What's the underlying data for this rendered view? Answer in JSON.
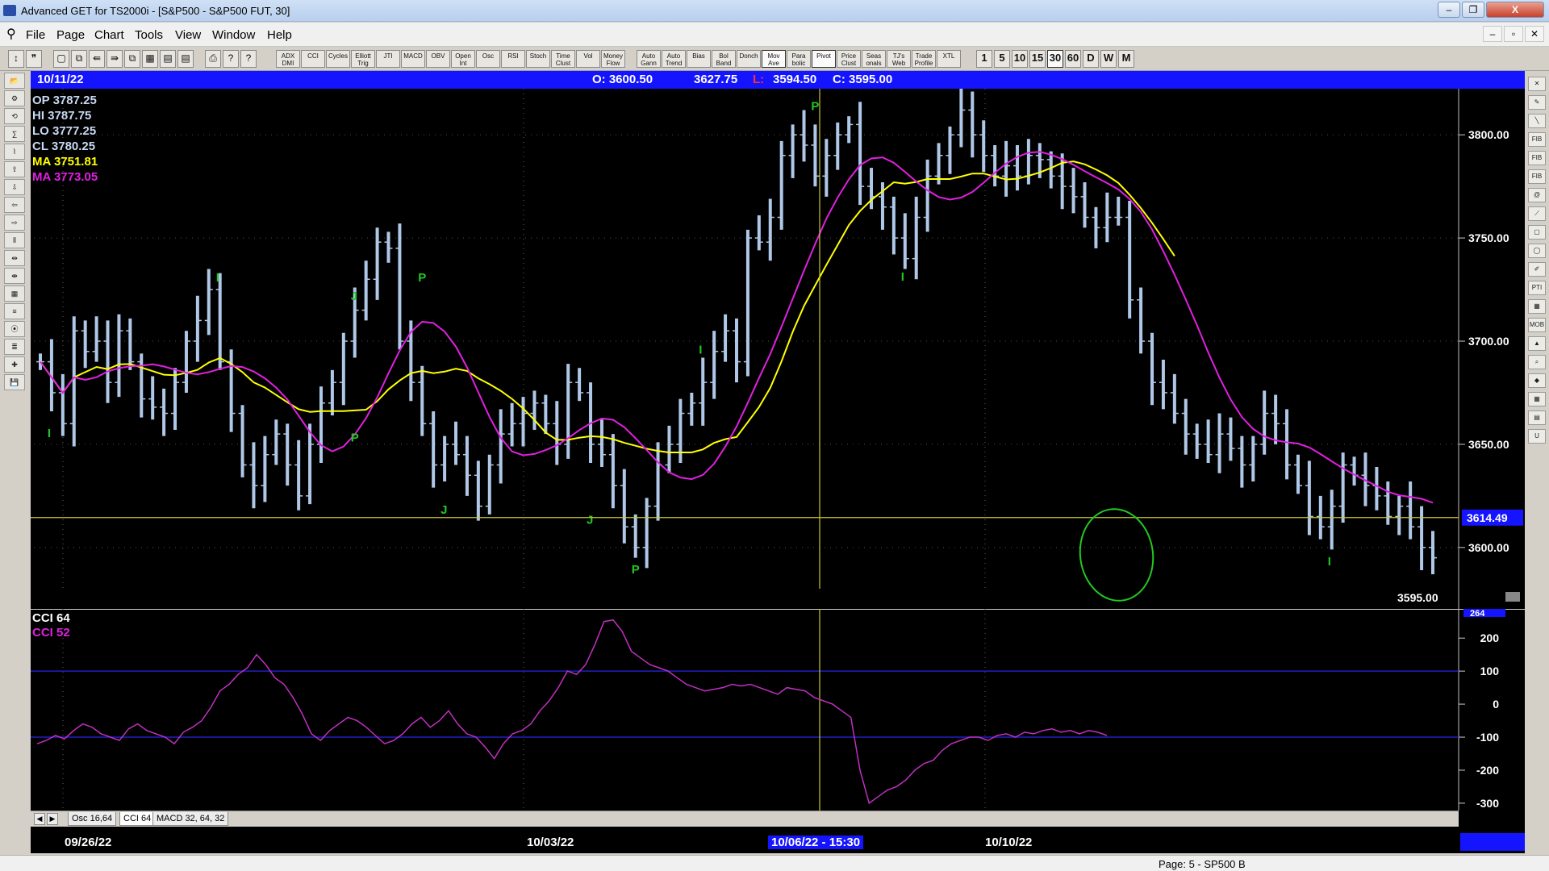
{
  "window": {
    "title": "Advanced GET for TS2000i - [S&P500 - S&P500 FUT, 30]",
    "minimize": "–",
    "restore": "❐",
    "close": "X"
  },
  "menu": {
    "items": [
      "File",
      "Page",
      "Chart",
      "Tools",
      "View",
      "Window",
      "Help"
    ],
    "mdi_buttons": [
      "–",
      "▫",
      "✕"
    ]
  },
  "toolbar": {
    "study_buttons": [
      "ADX DMI",
      "CCI",
      "Cycles",
      "Elliott Trig",
      "JTI",
      "MACD",
      "OBV",
      "Open Int",
      "Osc",
      "RSI",
      "Stoch",
      "Time Clust",
      "Vol",
      "Money Flow",
      "Auto Gann",
      "Auto Trend",
      "Bias",
      "Bol Band",
      "Donch",
      "Mov Ave",
      "Para bolic",
      "Pivot",
      "Price Clust",
      "Seas onals",
      "TJ's Web",
      "Trade Profile",
      "XTL"
    ],
    "interval_buttons": [
      "1",
      "5",
      "10",
      "15",
      "30",
      "60",
      "D",
      "W",
      "M"
    ],
    "active_interval": "30"
  },
  "left_tools": [
    "open",
    "studies",
    "reset",
    "study",
    "elliott",
    "up",
    "down",
    "left",
    "right",
    "bars",
    "spread",
    "compress",
    "grid",
    "lines",
    "gann",
    "fib",
    "cross",
    "save"
  ],
  "right_tools": [
    "close",
    "pencil",
    "line",
    "fib ret",
    "fib ext",
    "fib time",
    "spiral",
    "fan",
    "box",
    "ellipse",
    "brush",
    "PTI",
    "grid",
    "MOB",
    "up",
    "zoom",
    "paint",
    "grid2",
    "calc",
    "magnet"
  ],
  "info_bar": {
    "date": "10/11/22",
    "open": "O: 3600.50",
    "high": "3627.75",
    "low_label": "L:",
    "low_value": "3594.50",
    "close": "C: 3595.00"
  },
  "ohlc_panel": {
    "op": "OP  3787.25",
    "hi": "HI   3787.75",
    "lo": "LO  3777.25",
    "cl": "CL  3780.25",
    "ma1": "MA  3751.81",
    "ma2": "MA  3773.05"
  },
  "price_axis": {
    "ticks": [
      "3800.00",
      "3750.00",
      "3700.00",
      "3650.00",
      "3600.00"
    ],
    "cursor_price": "3614.49",
    "last_price": "3595.00"
  },
  "indicator": {
    "label1": "CCI 64",
    "label2": "CCI  52",
    "ticks": [
      "200",
      "100",
      "0",
      "-100",
      "-200",
      "-300"
    ],
    "top_value": "264"
  },
  "indicator_tabs": {
    "nav_left": "◀",
    "nav_right": "▶",
    "tabs": [
      "Osc 16,64",
      "CCI 64",
      "MACD 32, 64, 32"
    ],
    "active": "CCI 64"
  },
  "dates": {
    "d1": "09/26/22",
    "d2": "10/03/22",
    "d3": "10/06/22 - 15:30",
    "d4": "10/10/22"
  },
  "status": {
    "page": "Page: 5 - SP500 B"
  },
  "colors": {
    "background": "#000000",
    "bars": "#b0c8e8",
    "ma_yellow": "#ffff00",
    "ma_magenta": "#e020e0",
    "cci": "#c030c0",
    "pivot_green": "#22c822",
    "cursor": "#c8c832",
    "info_blue": "#1414ff"
  },
  "chart_data": [
    {
      "type": "ohlc",
      "title": "S&P500 - S&P500 FUT, 30",
      "ylim": [
        3580,
        3820
      ],
      "pivot_labels": [
        "I",
        "I",
        "P",
        "J",
        "P",
        "J",
        "J",
        "P",
        "I",
        "P",
        "I",
        "I"
      ],
      "series": [
        {
          "name": "Price",
          "close": [
            3690,
            3675,
            3660,
            3705,
            3695,
            3700,
            3680,
            3705,
            3690,
            3672,
            3668,
            3665,
            3680,
            3700,
            3710,
            3725,
            3690,
            3665,
            3640,
            3630,
            3645,
            3655,
            3640,
            3625,
            3650,
            3670,
            3680,
            3700,
            3715,
            3730,
            3748,
            3745,
            3700,
            3680,
            3660,
            3640,
            3650,
            3645,
            3635,
            3620,
            3640,
            3655,
            3660,
            3665,
            3670,
            3660,
            3650,
            3680,
            3675,
            3650,
            3645,
            3630,
            3610,
            3600,
            3620,
            3640,
            3650,
            3665,
            3670,
            3680,
            3695,
            3705,
            3690,
            3750,
            3748,
            3760,
            3790,
            3800,
            3795,
            3780,
            3790,
            3800,
            3805,
            3775,
            3770,
            3765,
            3750,
            3740,
            3760,
            3780,
            3790,
            3800,
            3812,
            3800,
            3790,
            3780,
            3785,
            3780,
            3790,
            3788,
            3780,
            3775,
            3770,
            3760,
            3755,
            3760,
            3760,
            3720,
            3700,
            3680,
            3675,
            3665,
            3655,
            3650,
            3645,
            3655,
            3648,
            3640,
            3650,
            3665,
            3660,
            3640,
            3630,
            3615,
            3610,
            3620,
            3640,
            3635,
            3630,
            3625,
            3615,
            3620,
            3610,
            3600,
            3595
          ]
        },
        {
          "name": "MA",
          "value_last": 3751.81
        },
        {
          "name": "MA",
          "value_last": 3773.05
        }
      ]
    },
    {
      "type": "line",
      "title": "CCI 64",
      "ylim": [
        -310,
        264
      ],
      "series": [
        {
          "name": "CCI 64",
          "values": [
            -120,
            -110,
            -95,
            -105,
            -80,
            -60,
            -70,
            -90,
            -100,
            -110,
            -75,
            -60,
            -80,
            -90,
            -100,
            -120,
            -85,
            -70,
            -50,
            -10,
            40,
            60,
            90,
            110,
            150,
            120,
            80,
            60,
            20,
            -30,
            -90,
            -110,
            -80,
            -60,
            -40,
            -50,
            -70,
            -95,
            -120,
            -110,
            -90,
            -60,
            -40,
            -70,
            -50,
            -20,
            -60,
            -90,
            -100,
            -130,
            -165,
            -120,
            -90,
            -80,
            -60,
            -20,
            10,
            50,
            100,
            90,
            120,
            180,
            250,
            255,
            220,
            160,
            140,
            120,
            110,
            100,
            80,
            60,
            50,
            40,
            45,
            50,
            60,
            55,
            60,
            50,
            40,
            30,
            50,
            45,
            40,
            20,
            10,
            0,
            -20,
            -40,
            -200,
            -300,
            -280,
            -260,
            -250,
            -230,
            -200,
            -180,
            -170,
            -140,
            -120,
            -110,
            -100,
            -100,
            -110,
            -95,
            -90,
            -100,
            -85,
            -90,
            -80,
            -75,
            -85,
            -80,
            -90,
            -80,
            -85,
            -95
          ]
        }
      ]
    }
  ]
}
